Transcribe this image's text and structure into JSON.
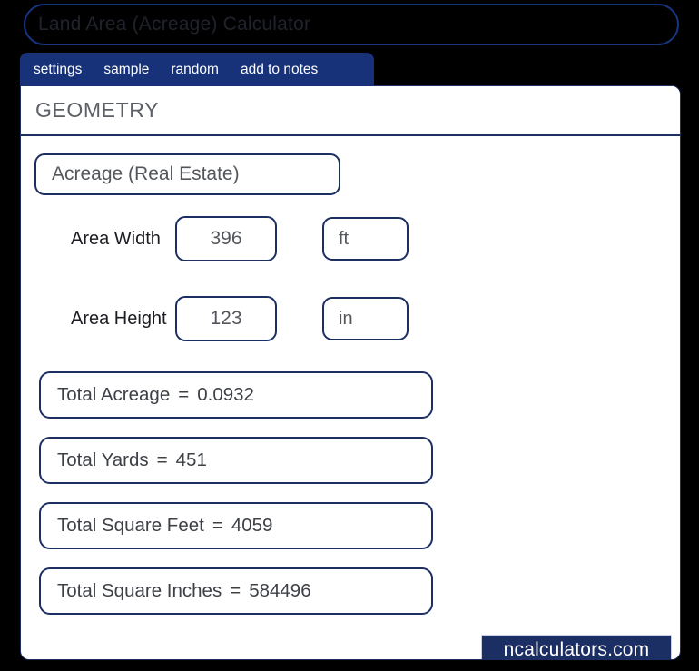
{
  "window": {
    "title": "Land Area (Acreage) Calculator"
  },
  "tabs": [
    {
      "label": "settings"
    },
    {
      "label": "sample"
    },
    {
      "label": "random"
    },
    {
      "label": "add to notes"
    }
  ],
  "section": {
    "title": "GEOMETRY"
  },
  "calculator": {
    "mode_select": {
      "value": "Acreage (Real Estate)"
    },
    "fields": [
      {
        "label": "Area Width",
        "value": "396",
        "unit": "ft"
      },
      {
        "label": "Area Height",
        "value": "123",
        "unit": "in"
      }
    ],
    "results": [
      {
        "label": "Total Acreage",
        "eq": "=",
        "value": "0.0932"
      },
      {
        "label": "Total Yards",
        "eq": "=",
        "value": "451"
      },
      {
        "label": "Total Square Feet",
        "eq": "=",
        "value": "4059"
      },
      {
        "label": "Total Square Inches",
        "eq": "=",
        "value": "584496"
      }
    ]
  },
  "brand": {
    "label": "ncalculators.com"
  },
  "colors": {
    "page_background": "#000000",
    "accent_navy": "#1b2f63",
    "tab_bar": "#173278",
    "title_border": "#16357f",
    "card_background": "#ffffff",
    "label_text": "#1b1d22",
    "value_text": "#53565c"
  }
}
